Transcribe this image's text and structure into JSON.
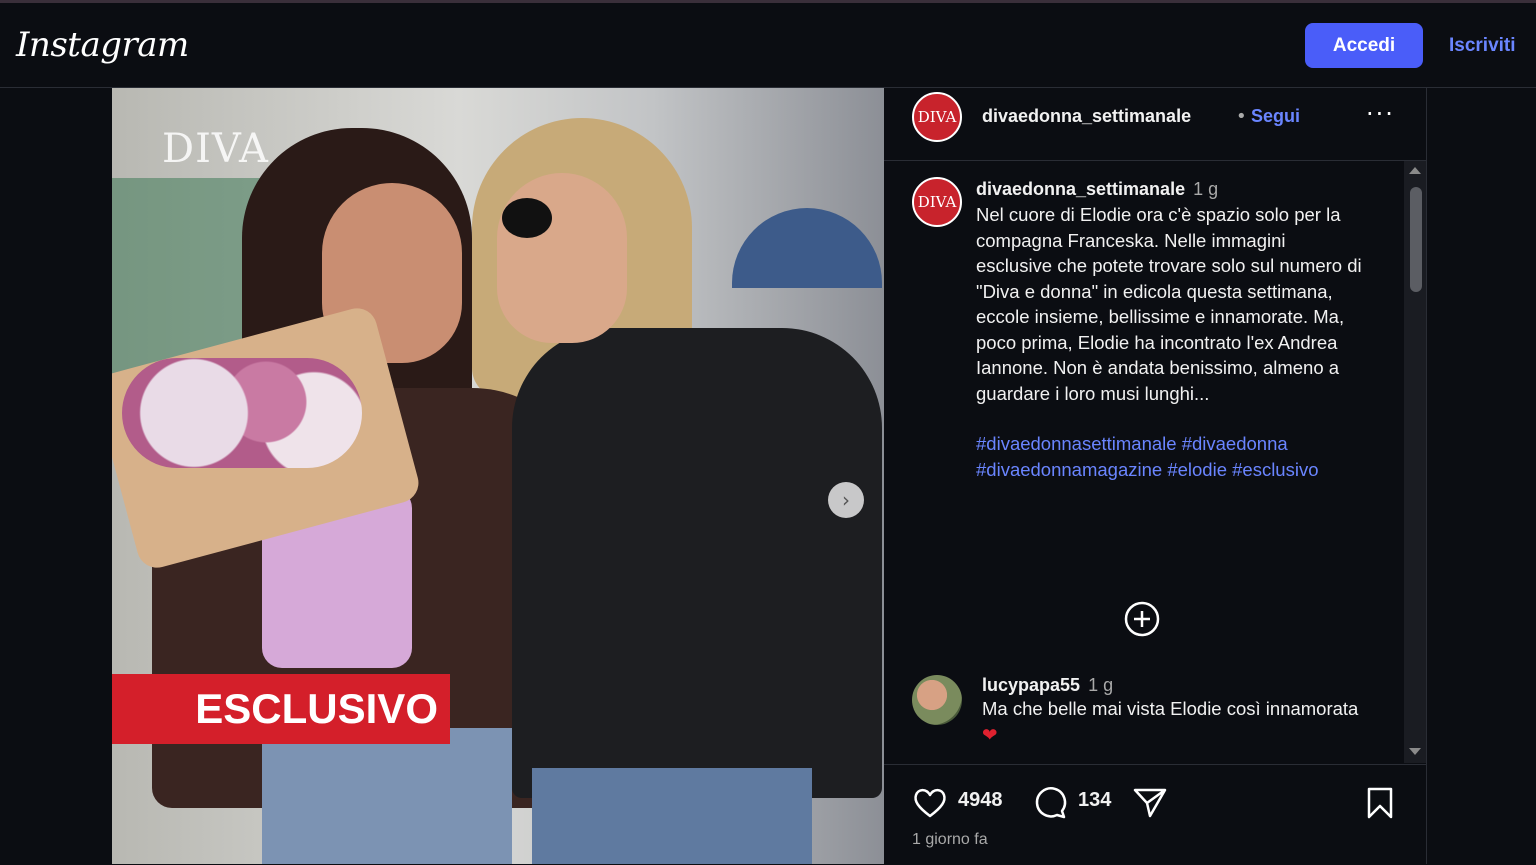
{
  "header": {
    "logo": "Instagram",
    "login_label": "Accedi",
    "signup_label": "Iscriviti"
  },
  "photo": {
    "watermark": "DIVA",
    "badge": "ESCLUSIVO",
    "next_icon": "chevron-right-icon"
  },
  "post": {
    "avatar_text": "DIVA",
    "username": "divaedonna_settimanale",
    "separator": "•",
    "follow_label": "Segui",
    "more_icon": "···"
  },
  "caption": {
    "username": "divaedonna_settimanale",
    "time": "1 g",
    "text": "Nel cuore di Elodie ora c'è spazio solo per la compagna Franceska. Nelle immagini esclusive che potete trovare solo sul numero di \"Diva e donna\" in edicola questa settimana, eccole insieme, bellissime e innamorate. Ma, poco prima, Elodie ha incontrato l'ex Andrea Iannone. Non è andata benissimo, almeno a guardare i loro musi lunghi...",
    "hashtags": "#divaedonnasettimanale #divaedonna #divaedonnamagazine #elodie #esclusivo"
  },
  "comments": [
    {
      "username": "lucypapa55",
      "time": "1 g",
      "text": "Ma che belle mai vista Elodie così innamorata",
      "emoji": "❤"
    }
  ],
  "actions": {
    "likes": "4948",
    "comments": "134",
    "date": "1 giorno fa"
  },
  "colors": {
    "background": "#0b0d12",
    "accent": "#4a5df9",
    "link": "#6a85ff",
    "badge_red": "#d41f2a",
    "heart": "#e0212f"
  }
}
